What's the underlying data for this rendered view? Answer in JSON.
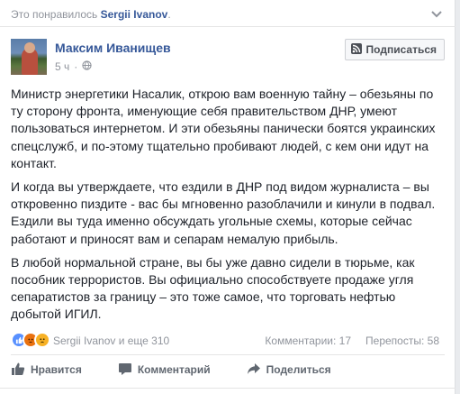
{
  "liked_bar": {
    "prefix": "Это понравилось",
    "user": "Sergii Ivanov",
    "suffix": "."
  },
  "post": {
    "author": "Максим Иванищев",
    "time": "5 ч",
    "privacy_icon": "globe-icon",
    "subscribe_label": "Подписаться",
    "paragraphs": [
      "Министр энергетики Насалик, открою вам военную тайну – обезьяны по ту сторону фронта, именующие себя правительством ДНР, умеют пользоваться интернетом. И эти обезьяны панически боятся украинских спецслужб, и по-этому тщательно пробивают людей, с кем они идут на контакт.",
      "И когда вы утверждаете, что ездили в ДНР под видом журналиста – вы откровенно пиздите - вас бы мгновенно разоблачили и кинули в подвал. Ездили вы туда именно обсуждать угольные схемы, которые сейчас работают и приносят вам и сепарам немалую прибыль.",
      "В любой нормальной стране, вы бы уже давно сидели в тюрьме, как пособник террористов. Вы официально способствуете продаже угля сепаратистов за границу – это тоже самое, что торговать нефтью добытой ИГИЛ."
    ]
  },
  "reactions": {
    "icons": [
      "like-reaction-icon",
      "angry-reaction-icon",
      "sad-reaction-icon"
    ],
    "text": "Sergii Ivanov и еще 310",
    "comments": "Комментарии: 17",
    "shares": "Перепосты: 58"
  },
  "actions": {
    "like": "Нравится",
    "comment": "Комментарий",
    "share": "Поделиться"
  }
}
